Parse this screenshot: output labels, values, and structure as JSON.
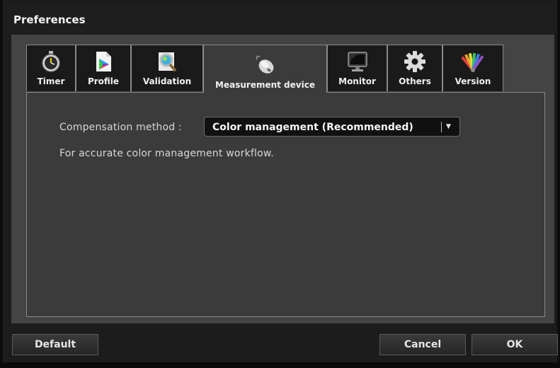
{
  "window": {
    "title": "Preferences"
  },
  "tabs": [
    {
      "label": "Timer",
      "icon": "stopwatch-icon"
    },
    {
      "label": "Profile",
      "icon": "color-profile-icon"
    },
    {
      "label": "Validation",
      "icon": "magnifier-icon"
    },
    {
      "label": "Measurement device",
      "icon": "measurement-device-icon",
      "active": true
    },
    {
      "label": "Monitor",
      "icon": "monitor-icon"
    },
    {
      "label": "Others",
      "icon": "gear-icon"
    },
    {
      "label": "Version",
      "icon": "color-fan-icon"
    }
  ],
  "panel": {
    "compensation_label": "Compensation method :",
    "compensation_value": "Color management (Recommended)",
    "description": "For accurate color management workflow."
  },
  "buttons": {
    "default": "Default",
    "cancel": "Cancel",
    "ok": "OK"
  }
}
